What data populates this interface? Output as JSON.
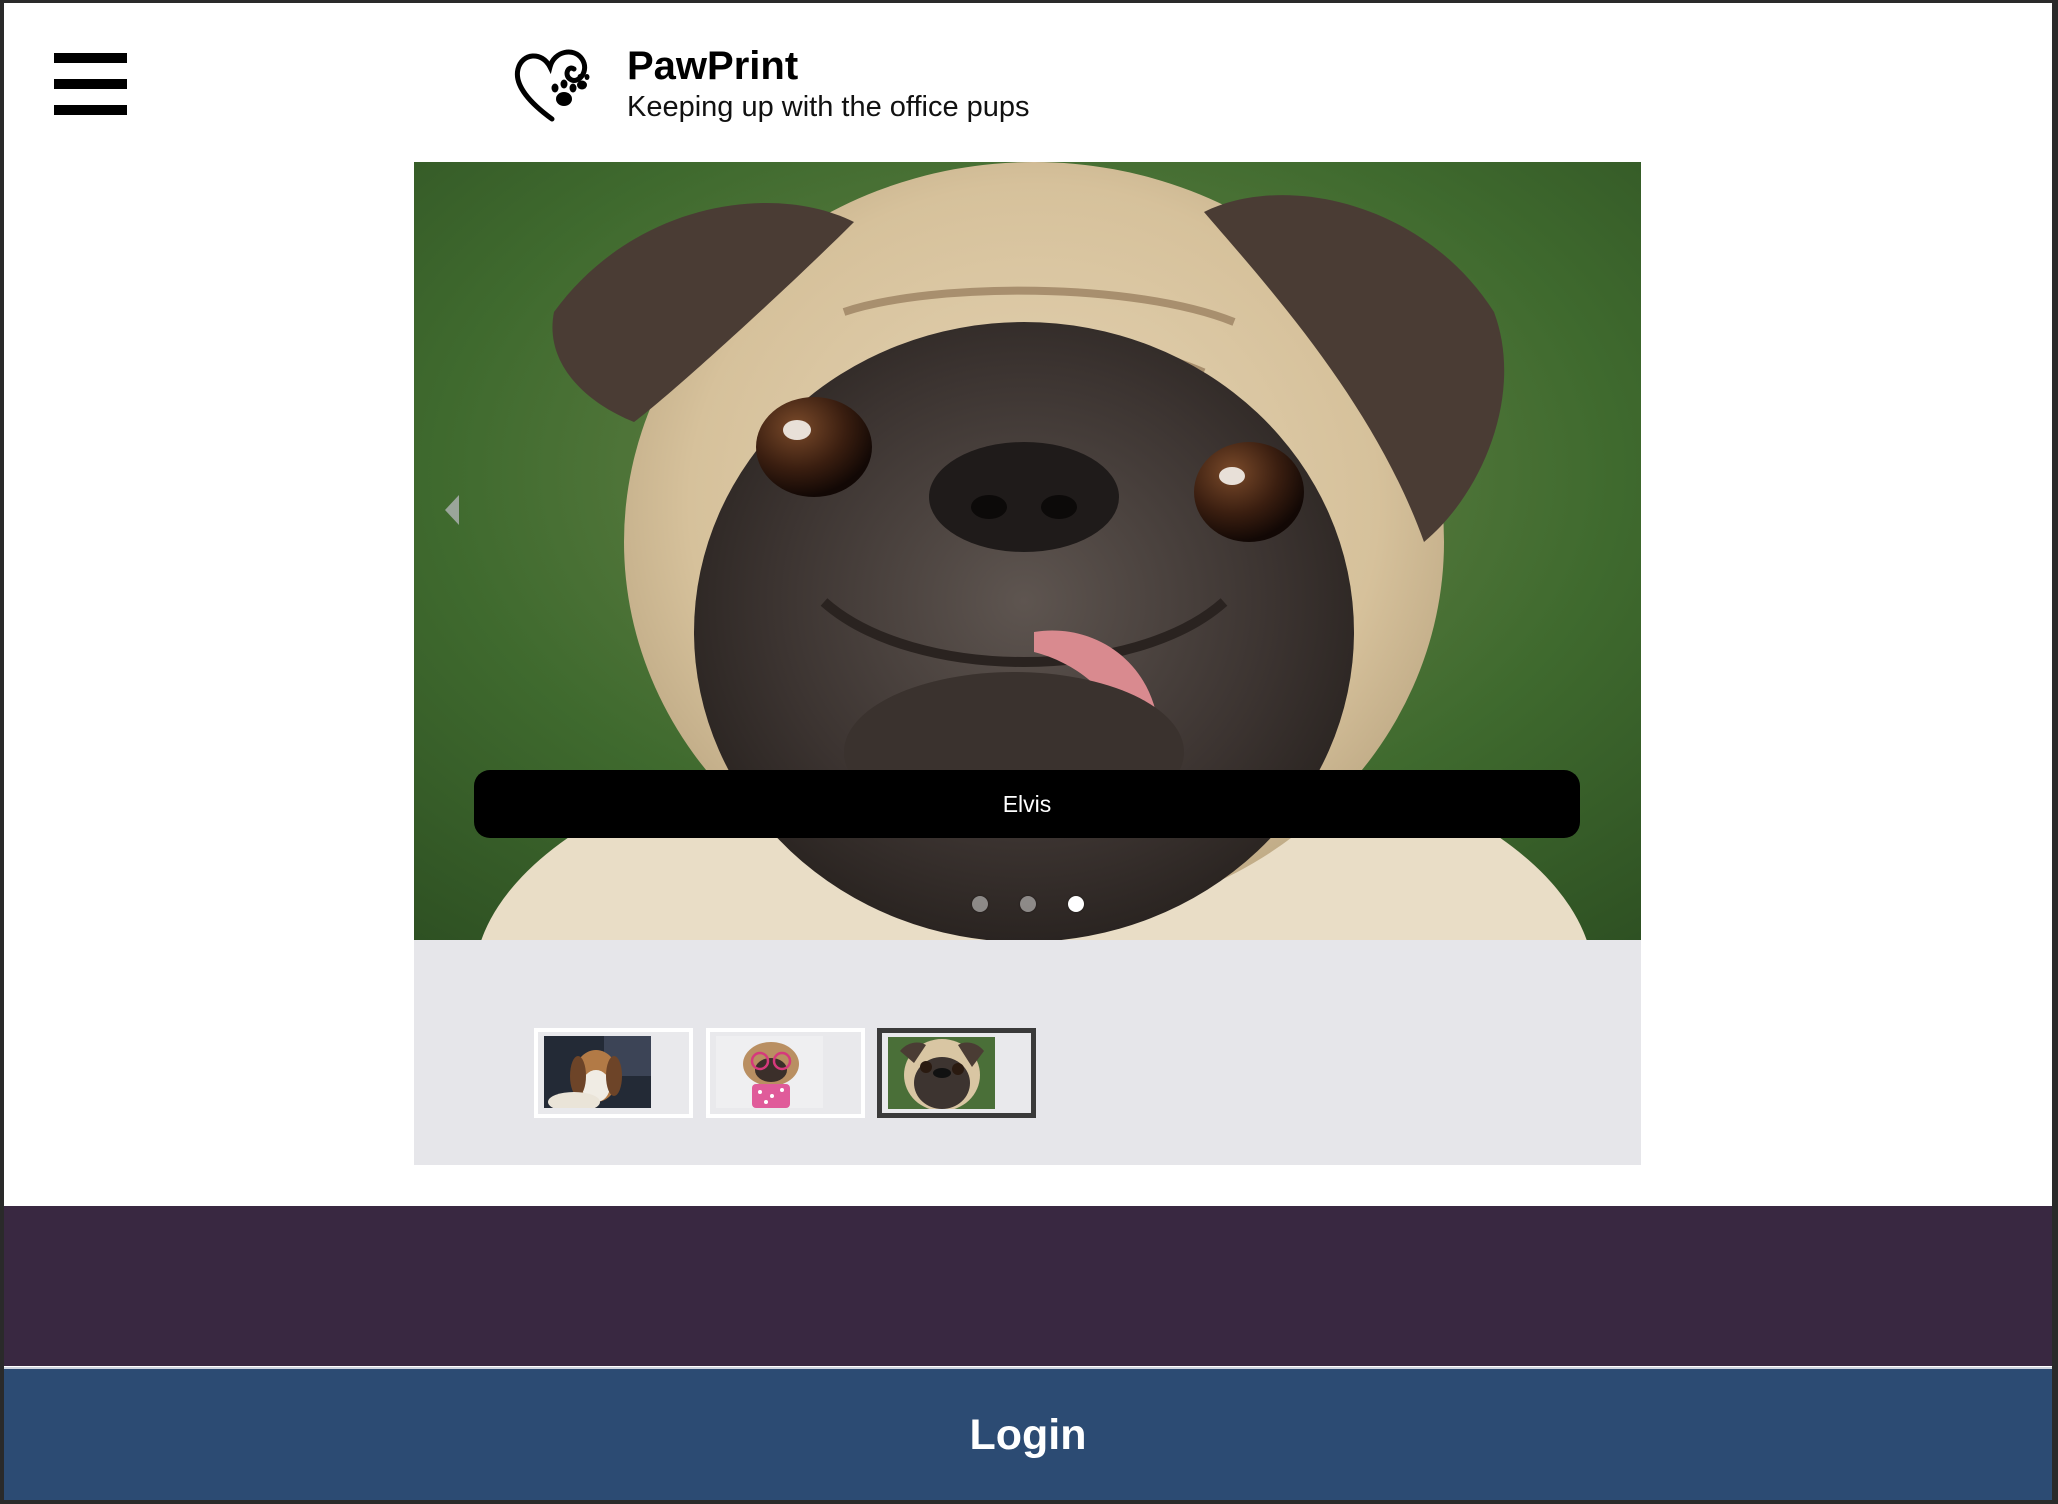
{
  "header": {
    "menu_icon": "hamburger-menu-icon",
    "logo_icon": "heart-paw-icon",
    "title": "PawPrint",
    "tagline": "Keeping up with the office pups"
  },
  "carousel": {
    "prev_icon": "triangle-left-icon",
    "current_caption": "Elvis",
    "slide_count": 3,
    "active_index": 3,
    "dots": [
      {
        "active": false
      },
      {
        "active": false
      },
      {
        "active": true
      }
    ]
  },
  "thumbnails": [
    {
      "subject": "basset-hound-photo",
      "active": false
    },
    {
      "subject": "pug-with-glasses-photo",
      "active": false
    },
    {
      "subject": "pug-closeup-photo",
      "active": true
    }
  ],
  "footer": {
    "login_label": "Login"
  },
  "colors": {
    "footer_band": "#392841",
    "login_bar": "#2c4b73",
    "thumb_strip": "#e6e6ea",
    "caption_bg": "#000000"
  }
}
